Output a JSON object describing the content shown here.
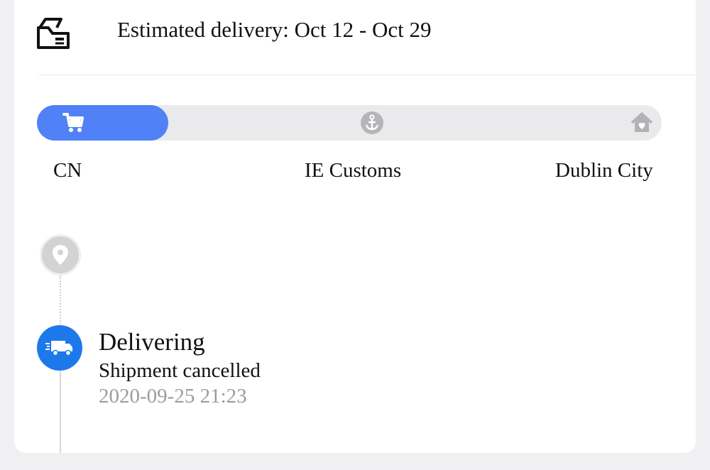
{
  "delivery": {
    "icon": "package-icon",
    "text": "Estimated delivery: Oct 12 - Oct 29"
  },
  "progress": {
    "filled_fraction": 0.21,
    "accent_color": "#5181f6",
    "stages": [
      {
        "label": "CN",
        "icon": "cart-icon",
        "active": true
      },
      {
        "label": "IE Customs",
        "icon": "anchor-icon",
        "active": false
      },
      {
        "label": "Dublin City",
        "icon": "home-icon",
        "active": false
      }
    ]
  },
  "timeline": {
    "nodes": [
      {
        "icon": "location-pin-icon",
        "color": "#d3d3d3"
      },
      {
        "icon": "truck-icon",
        "color": "#1d79ea"
      }
    ],
    "event": {
      "title": "Delivering",
      "description": "Shipment cancelled",
      "time": "2020-09-25 21:23"
    }
  }
}
